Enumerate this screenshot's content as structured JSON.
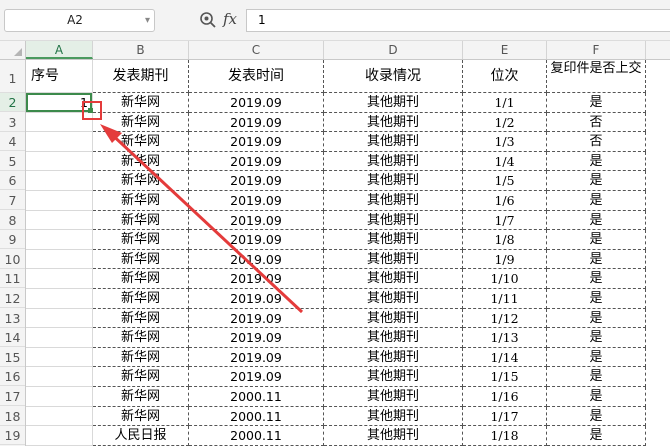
{
  "formula_bar": {
    "cell_ref": "A2",
    "formula_value": "1",
    "fx_label": "fx"
  },
  "columns": [
    "A",
    "B",
    "C",
    "D",
    "E",
    "F"
  ],
  "rows": [
    "1",
    "2",
    "3",
    "4",
    "5",
    "6",
    "7",
    "8",
    "9",
    "10",
    "11",
    "12",
    "13",
    "14",
    "15",
    "16",
    "17",
    "18",
    "19"
  ],
  "header_row": {
    "a": "序号",
    "b": "发表期刊",
    "c": "发表时间",
    "d": "收录情况",
    "e": "位次",
    "f": "复印件是否上交"
  },
  "data_rows": [
    {
      "a": "1",
      "b": "新华网",
      "c": "2019.09",
      "d": "其他期刊",
      "e": "1/1",
      "f": "是"
    },
    {
      "a": "",
      "b": "新华网",
      "c": "2019.09",
      "d": "其他期刊",
      "e": "1/2",
      "f": "否"
    },
    {
      "a": "",
      "b": "新华网",
      "c": "2019.09",
      "d": "其他期刊",
      "e": "1/3",
      "f": "否"
    },
    {
      "a": "",
      "b": "新华网",
      "c": "2019.09",
      "d": "其他期刊",
      "e": "1/4",
      "f": "是"
    },
    {
      "a": "",
      "b": "新华网",
      "c": "2019.09",
      "d": "其他期刊",
      "e": "1/5",
      "f": "是"
    },
    {
      "a": "",
      "b": "新华网",
      "c": "2019.09",
      "d": "其他期刊",
      "e": "1/6",
      "f": "是"
    },
    {
      "a": "",
      "b": "新华网",
      "c": "2019.09",
      "d": "其他期刊",
      "e": "1/7",
      "f": "是"
    },
    {
      "a": "",
      "b": "新华网",
      "c": "2019.09",
      "d": "其他期刊",
      "e": "1/8",
      "f": "是"
    },
    {
      "a": "",
      "b": "新华网",
      "c": "2019.09",
      "d": "其他期刊",
      "e": "1/9",
      "f": "是"
    },
    {
      "a": "",
      "b": "新华网",
      "c": "2019.09",
      "d": "其他期刊",
      "e": "1/10",
      "f": "是"
    },
    {
      "a": "",
      "b": "新华网",
      "c": "2019.09",
      "d": "其他期刊",
      "e": "1/11",
      "f": "是"
    },
    {
      "a": "",
      "b": "新华网",
      "c": "2019.09",
      "d": "其他期刊",
      "e": "1/12",
      "f": "是"
    },
    {
      "a": "",
      "b": "新华网",
      "c": "2019.09",
      "d": "其他期刊",
      "e": "1/13",
      "f": "是"
    },
    {
      "a": "",
      "b": "新华网",
      "c": "2019.09",
      "d": "其他期刊",
      "e": "1/14",
      "f": "是"
    },
    {
      "a": "",
      "b": "新华网",
      "c": "2019.09",
      "d": "其他期刊",
      "e": "1/15",
      "f": "是"
    },
    {
      "a": "",
      "b": "新华网",
      "c": "2000.11",
      "d": "其他期刊",
      "e": "1/16",
      "f": "是"
    },
    {
      "a": "",
      "b": "新华网",
      "c": "2000.11",
      "d": "其他期刊",
      "e": "1/17",
      "f": "是"
    },
    {
      "a": "",
      "b": "人民日报",
      "c": "2000.11",
      "d": "其他期刊",
      "e": "1/18",
      "f": "是"
    }
  ],
  "colors": {
    "selection": "#3c8a4b",
    "annotation": "#e43b3b"
  },
  "icons": [
    "zoom-formula-icon",
    "fx-icon",
    "dropdown-caret-icon",
    "select-all-icon",
    "fill-handle-icon",
    "annotation-arrow-icon"
  ]
}
